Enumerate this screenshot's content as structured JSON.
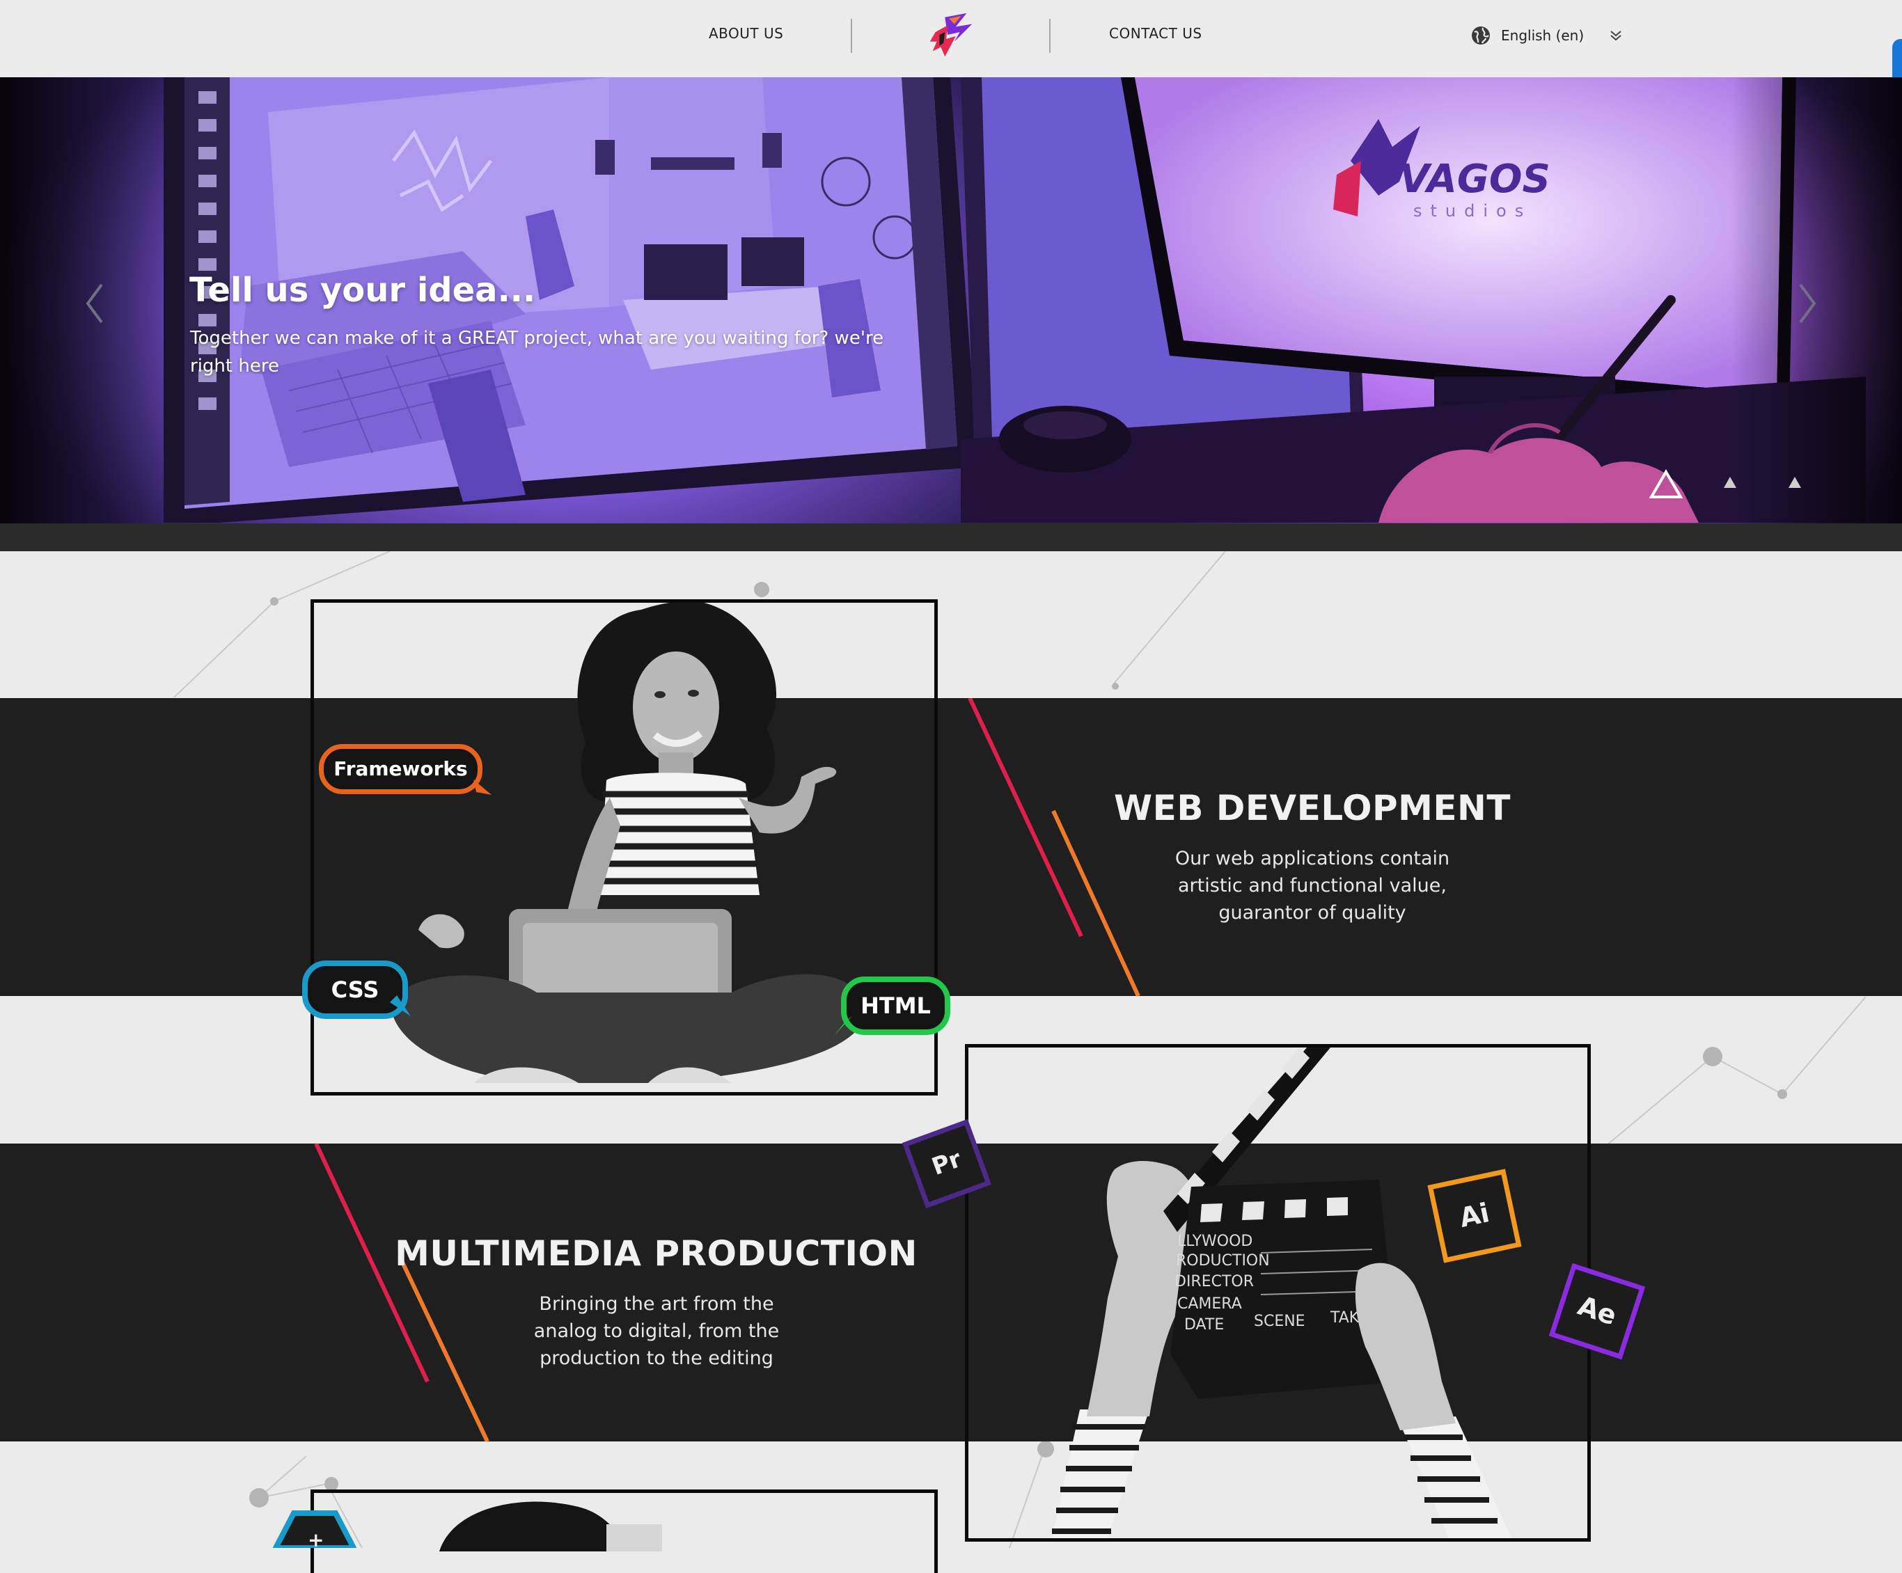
{
  "header": {
    "nav": {
      "about": "ABOUT US",
      "contact": "CONTACT US"
    },
    "language": {
      "label": "English (en)"
    }
  },
  "hero": {
    "title": "Tell us your idea...",
    "subtitle": "Together we can make of it a GREAT project, what are you waiting for? we're right here",
    "screen_logo_text": "VAGOS",
    "screen_logo_sub": "studios",
    "slides_total": 3,
    "active_slide": 1
  },
  "sections": {
    "web": {
      "title": "WEB DEVELOPMENT",
      "text": "Our web applications contain artistic and functional value, guarantor of quality",
      "tags": [
        "Frameworks",
        "CSS",
        "HTML"
      ]
    },
    "multimedia": {
      "title": "MULTIMEDIA PRODUCTION",
      "text": "Bringing the art from the analog to digital, from the production to the editing",
      "badges": [
        "Pr",
        "Ai",
        "Ae"
      ],
      "clapper": [
        "LLYWOOD",
        "RODUCTION",
        "DIRECTOR",
        "CAMERA",
        "DATE",
        "SCENE",
        "TAKE"
      ]
    }
  },
  "colors": {
    "accent_red": "#e0204a",
    "accent_orange": "#f07a2a",
    "frameworks": "#e8641e",
    "css": "#1a9ac9",
    "html": "#22c84a",
    "pr": "#4b2a8a",
    "ai": "#f39a1e",
    "ae": "#8a2be2"
  }
}
